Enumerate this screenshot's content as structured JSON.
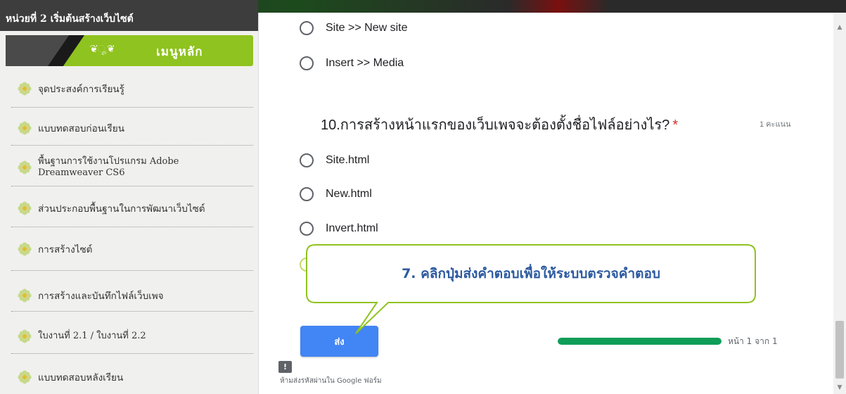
{
  "sidebar": {
    "header_title": "หน่วยที่ 2 เริ่มต้นสร้างเว็บไซต์",
    "menu_ornament": "❦ೄ❦",
    "menu_title": "เมนูหลัก",
    "items": [
      {
        "label": "จุดประสงค์การเรียนรู้"
      },
      {
        "label": "แบบทดสอบก่อนเรียน"
      },
      {
        "label": "พื้นฐานการใช้งานโปรแกรม Adobe Dreamweaver CS6"
      },
      {
        "label": "ส่วนประกอบพื้นฐานในการพัฒนาเว็บไซต์"
      },
      {
        "label": "การสร้างไซต์"
      },
      {
        "label": "การสร้างและบันทึกไฟล์เว็บเพจ"
      },
      {
        "label": "ใบงานที่ 2.1 / ใบงานที่ 2.2"
      },
      {
        "label": "แบบทดสอบหลังเรียน"
      }
    ]
  },
  "form": {
    "prev_options": [
      "Site >> New site",
      "Insert >> Media"
    ],
    "question": {
      "text": "10.การสร้างหน้าแรกของเว็บเพจจะต้องตั้งชื่อไฟล์อย่างไร?",
      "required_mark": "*",
      "points": "1 คะแนน",
      "options": [
        "Site.html",
        "New.html",
        "Invert.html"
      ]
    },
    "submit_label": "ส่ง",
    "progress": {
      "fraction": 1.0,
      "label": "หน้า 1 จาก 1"
    },
    "report_icon": "!",
    "footer_note": "ห้ามส่งรหัสผ่านใน Google ฟอร์ม"
  },
  "callout": {
    "text": "7. คลิกปุ่มส่งคำตอบเพื่อให้ระบบตรวจคำตอบ",
    "fill": "#ffffff",
    "border": "#8fc31f",
    "text_color": "#2c5aa0"
  },
  "colors": {
    "accent_green": "#8fc31f",
    "submit_blue": "#4285f4",
    "progress_green": "#0f9d58",
    "required_red": "#d93025"
  },
  "icons": {
    "sidebar_bullet": "flower-icon",
    "scroll_up": "▲",
    "scroll_down": "▼"
  }
}
